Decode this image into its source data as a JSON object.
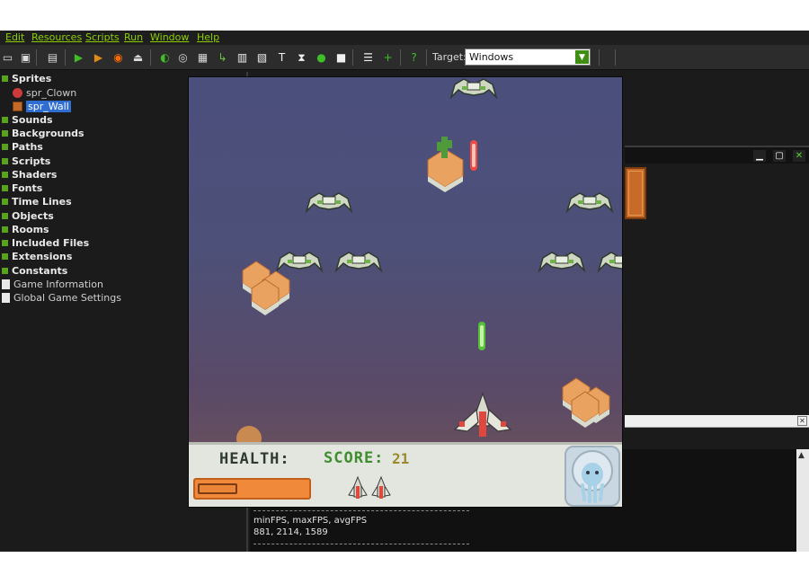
{
  "menu": [
    "Edit",
    "Resources",
    "Scripts",
    "Run",
    "Window",
    "Help"
  ],
  "toolbar": {
    "target_label": "Target:",
    "target_value": "Windows"
  },
  "tree": {
    "sprites": "Sprites",
    "spr_clown": "spr_Clown",
    "spr_wall": "spr_Wall",
    "sounds": "Sounds",
    "backgrounds": "Backgrounds",
    "paths": "Paths",
    "scripts": "Scripts",
    "shaders": "Shaders",
    "fonts": "Fonts",
    "time_lines": "Time Lines",
    "objects": "Objects",
    "rooms": "Rooms",
    "included_files": "Included Files",
    "extensions": "Extensions",
    "constants": "Constants",
    "game_information": "Game Information",
    "global_game_settings": "Global Game Settings"
  },
  "output": {
    "line1": "minFPS, maxFPS, avgFPS",
    "line2": "881, 2114, 1589"
  },
  "game": {
    "health_label": "HEALTH:",
    "score_label": "SCORE:",
    "score_value": "21",
    "health_fraction": 0.36,
    "lives": 2
  },
  "colors": {
    "menu_text": "#8ccf00",
    "tree_bullet": "#58a31e",
    "selection": "#2f6dd1",
    "health_bar": "#f08a3a",
    "score_text": "#3e8d2f"
  }
}
